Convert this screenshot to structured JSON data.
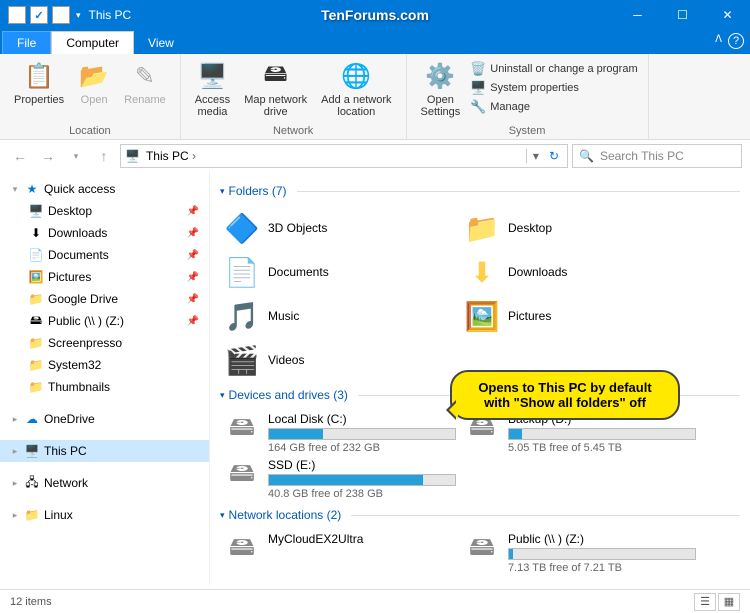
{
  "titlebar": {
    "title": "This PC",
    "watermark": "TenForums.com"
  },
  "tabs": {
    "file": "File",
    "computer": "Computer",
    "view": "View"
  },
  "ribbon": {
    "location": {
      "label": "Location",
      "properties": "Properties",
      "open": "Open",
      "rename": "Rename"
    },
    "network": {
      "label": "Network",
      "access_media": "Access\nmedia",
      "map_drive": "Map network\ndrive",
      "add_location": "Add a network\nlocation"
    },
    "system": {
      "label": "System",
      "open_settings": "Open\nSettings",
      "uninstall": "Uninstall or change a program",
      "sys_properties": "System properties",
      "manage": "Manage"
    }
  },
  "address": {
    "crumb": "This PC",
    "refresh_icon": "↻"
  },
  "search": {
    "placeholder": "Search This PC"
  },
  "tree": {
    "quick_access": "Quick access",
    "items": [
      {
        "label": "Desktop",
        "icon": "🖥️",
        "pinned": true
      },
      {
        "label": "Downloads",
        "icon": "⬇",
        "pinned": true
      },
      {
        "label": "Documents",
        "icon": "📄",
        "pinned": true
      },
      {
        "label": "Pictures",
        "icon": "🖼️",
        "pinned": true
      },
      {
        "label": "Google Drive",
        "icon": "📁",
        "pinned": true
      },
      {
        "label": "Public (\\\\              ) (Z:)",
        "icon": "🖴",
        "pinned": true
      },
      {
        "label": "Screenpresso",
        "icon": "📁",
        "pinned": false
      },
      {
        "label": "System32",
        "icon": "📁",
        "pinned": false
      },
      {
        "label": "Thumbnails",
        "icon": "📁",
        "pinned": false
      }
    ],
    "onedrive": "OneDrive",
    "this_pc": "This PC",
    "network": "Network",
    "linux": "Linux"
  },
  "groups": {
    "folders": {
      "title": "Folders (7)",
      "items": [
        {
          "label": "3D Objects"
        },
        {
          "label": "Desktop"
        },
        {
          "label": "Documents"
        },
        {
          "label": "Downloads"
        },
        {
          "label": "Music"
        },
        {
          "label": "Pictures"
        },
        {
          "label": "Videos"
        }
      ]
    },
    "drives": {
      "title": "Devices and drives (3)",
      "items": [
        {
          "label": "Local Disk (C:)",
          "sub": "164 GB free of 232 GB",
          "fill": 29
        },
        {
          "label": "Backup (D:)",
          "sub": "5.05 TB free of 5.45 TB",
          "fill": 7
        },
        {
          "label": "SSD (E:)",
          "sub": "40.8 GB free of 238 GB",
          "fill": 83
        }
      ]
    },
    "network": {
      "title": "Network locations (2)",
      "items": [
        {
          "label": "MyCloudEX2Ultra",
          "sub": ""
        },
        {
          "label": "Public (\\\\              ) (Z:)",
          "sub": "7.13 TB free of 7.21 TB",
          "fill": 2
        }
      ]
    }
  },
  "callout": "Opens to This PC by default with \"Show all folders\" off",
  "status": {
    "count": "12 items"
  }
}
